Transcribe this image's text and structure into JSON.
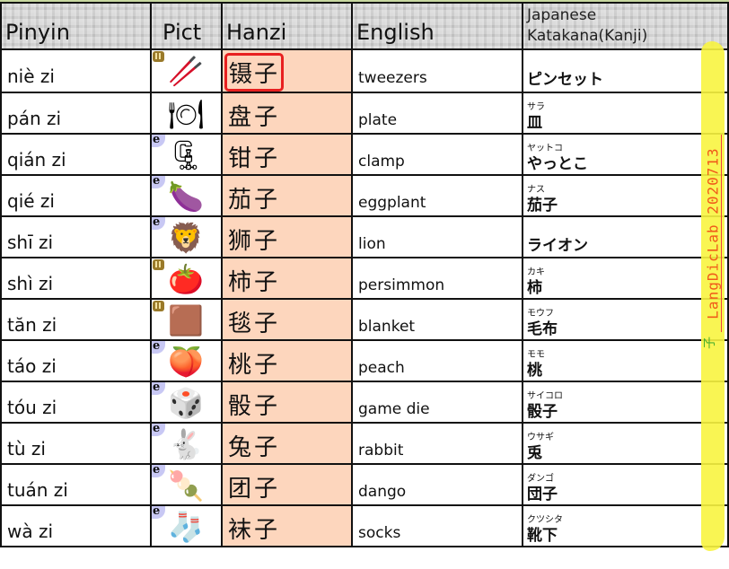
{
  "table": {
    "headers": {
      "pinyin": "Pinyin",
      "pict": "Pict",
      "hanzi": "Hanzi",
      "english": "English",
      "japanese_line1": "Japanese",
      "japanese_line2": "Katakana(Kanji)"
    },
    "rows": [
      {
        "pinyin": "niè zi",
        "pict_icon": "tweezers-icon",
        "pict_glyph": "🥢",
        "badge": "gold",
        "hanzi": "镊子",
        "highlighted": true,
        "english": "tweezers",
        "jp_reading": "",
        "jp_word": "ピンセット"
      },
      {
        "pinyin": "pán zi",
        "pict_icon": "plate-icon",
        "pict_glyph": "🍽",
        "badge": "none",
        "hanzi": "盘子",
        "english": "plate",
        "jp_reading": "サラ",
        "jp_word": "皿"
      },
      {
        "pinyin": "qián zi",
        "pict_icon": "clamp-icon",
        "pict_glyph": "🗜",
        "badge": "e",
        "hanzi": "钳子",
        "english": "clamp",
        "jp_reading": "ヤットコ",
        "jp_word": "やっとこ"
      },
      {
        "pinyin": "qié zi",
        "pict_icon": "eggplant-icon",
        "pict_glyph": "🍆",
        "badge": "e",
        "hanzi": "茄子",
        "english": "eggplant",
        "jp_reading": "ナス",
        "jp_word": "茄子"
      },
      {
        "pinyin": "shī zi",
        "pict_icon": "lion-icon",
        "pict_glyph": "🦁",
        "badge": "e",
        "hanzi": "狮子",
        "english": "lion",
        "jp_reading": "",
        "jp_word": "ライオン"
      },
      {
        "pinyin": "shì zi",
        "pict_icon": "persimmon-icon",
        "pict_glyph": "🍅",
        "badge": "gold",
        "hanzi": "柿子",
        "english": "persimmon",
        "jp_reading": "カキ",
        "jp_word": "柿"
      },
      {
        "pinyin": "tăn zi",
        "pict_icon": "blanket-icon",
        "pict_glyph": "🟫",
        "badge": "gold",
        "hanzi": "毯子",
        "english": "blanket",
        "jp_reading": "モウフ",
        "jp_word": "毛布"
      },
      {
        "pinyin": "táo zi",
        "pict_icon": "peach-icon",
        "pict_glyph": "🍑",
        "badge": "e",
        "hanzi": "桃子",
        "english": "peach",
        "jp_reading": "モモ",
        "jp_word": "桃"
      },
      {
        "pinyin": "tóu zi",
        "pict_icon": "game-die-icon",
        "pict_glyph": "🎲",
        "badge": "e",
        "hanzi": "骰子",
        "english": "game die",
        "jp_reading": "サイコロ",
        "jp_word": "骰子"
      },
      {
        "pinyin": "tù zi",
        "pict_icon": "rabbit-icon",
        "pict_glyph": "🐇",
        "badge": "e",
        "hanzi": "兔子",
        "english": "rabbit",
        "jp_reading": "ウサギ",
        "jp_word": "兎"
      },
      {
        "pinyin": "tuán zi",
        "pict_icon": "dango-icon",
        "pict_glyph": "🍡",
        "badge": "e",
        "hanzi": "团子",
        "english": "dango",
        "jp_reading": "ダンゴ",
        "jp_word": "団子"
      },
      {
        "pinyin": "wà zi",
        "pict_icon": "socks-icon",
        "pict_glyph": "🧦",
        "badge": "e",
        "hanzi": "袜子",
        "english": "socks",
        "jp_reading": "クツシタ",
        "jp_word": "靴下"
      }
    ]
  },
  "badge_e_label": "e",
  "annotation": {
    "stamp_text": "LangDicLab 2020713",
    "mark": "子",
    "highlight_color": "#f8f440",
    "stamp_color": "#f05a1a"
  },
  "colors": {
    "hanzi_bg": "#fdd6bd",
    "hanzi_box": "#e82020",
    "header_bg": "#d4d4d4"
  }
}
